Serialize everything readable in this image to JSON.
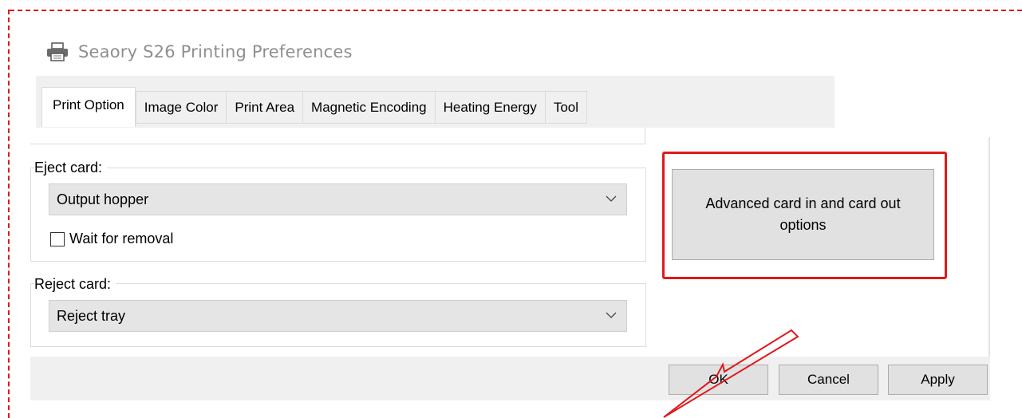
{
  "window": {
    "title": "Seaory S26 Printing Preferences",
    "icon": "printer-icon"
  },
  "tabs": [
    {
      "label": "Print Option",
      "active": true
    },
    {
      "label": "Image Color",
      "active": false
    },
    {
      "label": "Print Area",
      "active": false
    },
    {
      "label": "Magnetic Encoding",
      "active": false
    },
    {
      "label": "Heating Energy",
      "active": false
    },
    {
      "label": "Tool",
      "active": false
    }
  ],
  "eject_card": {
    "label": "Eject card:",
    "selected": "Output hopper",
    "wait_for_removal": {
      "label": "Wait for removal",
      "checked": false
    }
  },
  "reject_card": {
    "label": "Reject card:",
    "selected": "Reject tray"
  },
  "advanced_button": {
    "label": "Advanced card in and card out options"
  },
  "footer": {
    "ok": "OK",
    "cancel": "Cancel",
    "apply": "Apply"
  },
  "colors": {
    "annotation": "#e0191b",
    "button_bg": "#e1e1e1",
    "dialog_bg": "#f0f0f0"
  }
}
